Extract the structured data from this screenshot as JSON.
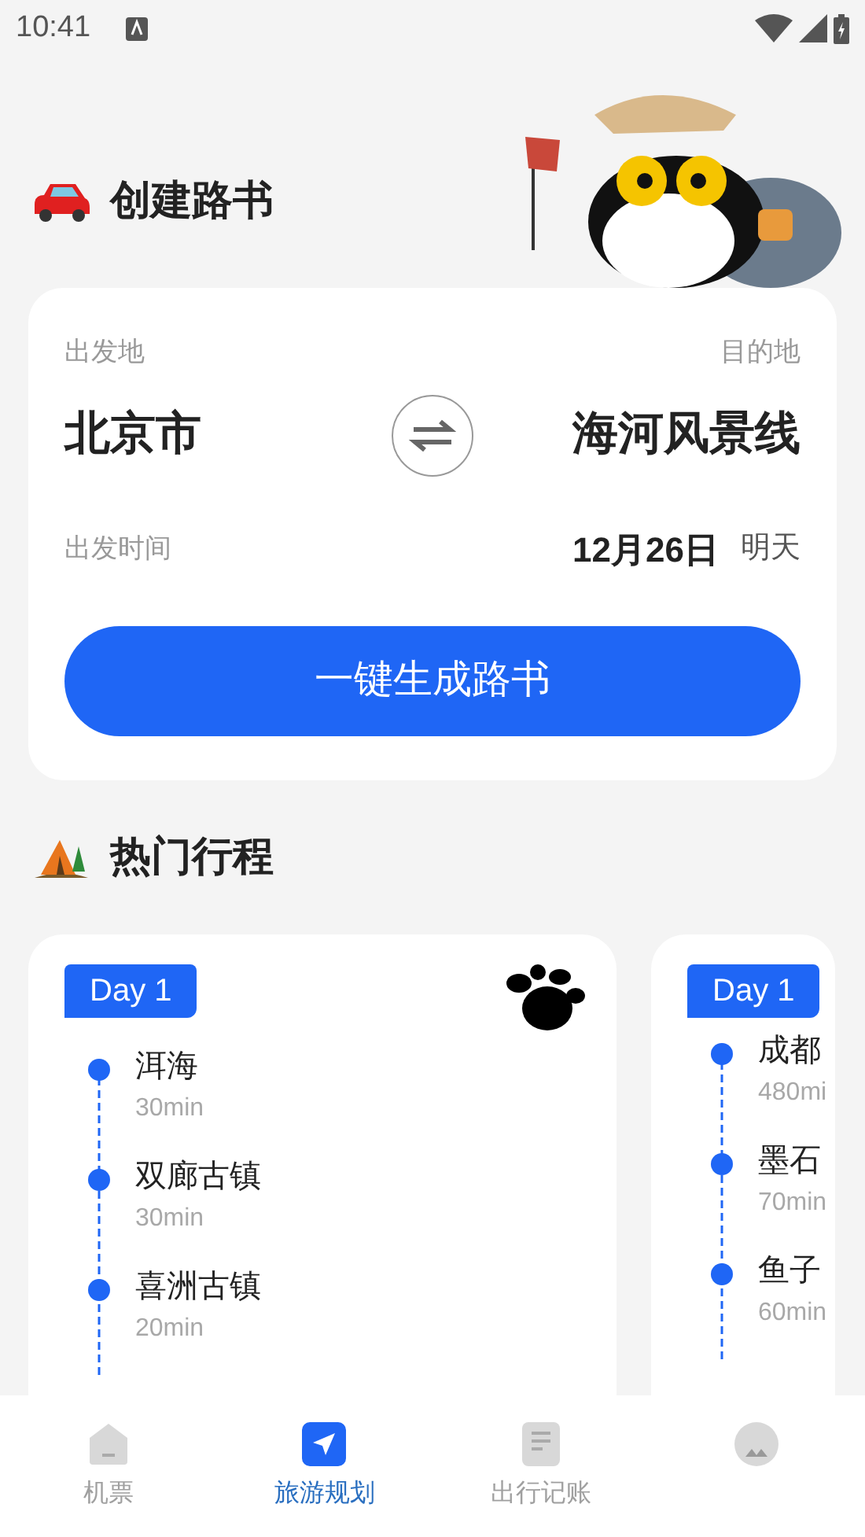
{
  "status_bar": {
    "time": "10:41"
  },
  "create": {
    "title": "创建路书",
    "from_label": "出发地",
    "to_label": "目的地",
    "from": "北京市",
    "to": "海河风景线",
    "time_label": "出发时间",
    "date": "12月26日",
    "day_hint": "明天",
    "button": "一键生成路书"
  },
  "popular": {
    "title": "热门行程",
    "trips": [
      {
        "day": "Day 1",
        "stops": [
          {
            "name": "洱海",
            "duration": "30min"
          },
          {
            "name": "双廊古镇",
            "duration": "30min"
          },
          {
            "name": "喜洲古镇",
            "duration": "20min"
          }
        ]
      },
      {
        "day": "Day 1",
        "stops": [
          {
            "name": "成都",
            "duration": "480mi"
          },
          {
            "name": "墨石",
            "duration": "70min"
          },
          {
            "name": "鱼子",
            "duration": "60min"
          }
        ]
      }
    ]
  },
  "tabs": [
    {
      "label": "机票",
      "kind": "home",
      "selected": false
    },
    {
      "label": "旅游规划",
      "kind": "navigate",
      "selected": true
    },
    {
      "label": "出行记账",
      "kind": "document",
      "selected": false
    },
    {
      "kind": "avatar",
      "selected": false
    }
  ]
}
